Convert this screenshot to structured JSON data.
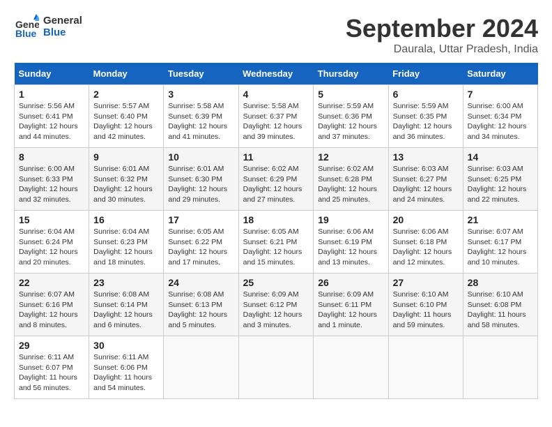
{
  "logo": {
    "line1": "General",
    "line2": "Blue"
  },
  "title": "September 2024",
  "location": "Daurala, Uttar Pradesh, India",
  "days_of_week": [
    "Sunday",
    "Monday",
    "Tuesday",
    "Wednesday",
    "Thursday",
    "Friday",
    "Saturday"
  ],
  "weeks": [
    [
      {
        "day": "1",
        "info": "Sunrise: 5:56 AM\nSunset: 6:41 PM\nDaylight: 12 hours\nand 44 minutes."
      },
      {
        "day": "2",
        "info": "Sunrise: 5:57 AM\nSunset: 6:40 PM\nDaylight: 12 hours\nand 42 minutes."
      },
      {
        "day": "3",
        "info": "Sunrise: 5:58 AM\nSunset: 6:39 PM\nDaylight: 12 hours\nand 41 minutes."
      },
      {
        "day": "4",
        "info": "Sunrise: 5:58 AM\nSunset: 6:37 PM\nDaylight: 12 hours\nand 39 minutes."
      },
      {
        "day": "5",
        "info": "Sunrise: 5:59 AM\nSunset: 6:36 PM\nDaylight: 12 hours\nand 37 minutes."
      },
      {
        "day": "6",
        "info": "Sunrise: 5:59 AM\nSunset: 6:35 PM\nDaylight: 12 hours\nand 36 minutes."
      },
      {
        "day": "7",
        "info": "Sunrise: 6:00 AM\nSunset: 6:34 PM\nDaylight: 12 hours\nand 34 minutes."
      }
    ],
    [
      {
        "day": "8",
        "info": "Sunrise: 6:00 AM\nSunset: 6:33 PM\nDaylight: 12 hours\nand 32 minutes."
      },
      {
        "day": "9",
        "info": "Sunrise: 6:01 AM\nSunset: 6:32 PM\nDaylight: 12 hours\nand 30 minutes."
      },
      {
        "day": "10",
        "info": "Sunrise: 6:01 AM\nSunset: 6:30 PM\nDaylight: 12 hours\nand 29 minutes."
      },
      {
        "day": "11",
        "info": "Sunrise: 6:02 AM\nSunset: 6:29 PM\nDaylight: 12 hours\nand 27 minutes."
      },
      {
        "day": "12",
        "info": "Sunrise: 6:02 AM\nSunset: 6:28 PM\nDaylight: 12 hours\nand 25 minutes."
      },
      {
        "day": "13",
        "info": "Sunrise: 6:03 AM\nSunset: 6:27 PM\nDaylight: 12 hours\nand 24 minutes."
      },
      {
        "day": "14",
        "info": "Sunrise: 6:03 AM\nSunset: 6:25 PM\nDaylight: 12 hours\nand 22 minutes."
      }
    ],
    [
      {
        "day": "15",
        "info": "Sunrise: 6:04 AM\nSunset: 6:24 PM\nDaylight: 12 hours\nand 20 minutes."
      },
      {
        "day": "16",
        "info": "Sunrise: 6:04 AM\nSunset: 6:23 PM\nDaylight: 12 hours\nand 18 minutes."
      },
      {
        "day": "17",
        "info": "Sunrise: 6:05 AM\nSunset: 6:22 PM\nDaylight: 12 hours\nand 17 minutes."
      },
      {
        "day": "18",
        "info": "Sunrise: 6:05 AM\nSunset: 6:21 PM\nDaylight: 12 hours\nand 15 minutes."
      },
      {
        "day": "19",
        "info": "Sunrise: 6:06 AM\nSunset: 6:19 PM\nDaylight: 12 hours\nand 13 minutes."
      },
      {
        "day": "20",
        "info": "Sunrise: 6:06 AM\nSunset: 6:18 PM\nDaylight: 12 hours\nand 12 minutes."
      },
      {
        "day": "21",
        "info": "Sunrise: 6:07 AM\nSunset: 6:17 PM\nDaylight: 12 hours\nand 10 minutes."
      }
    ],
    [
      {
        "day": "22",
        "info": "Sunrise: 6:07 AM\nSunset: 6:16 PM\nDaylight: 12 hours\nand 8 minutes."
      },
      {
        "day": "23",
        "info": "Sunrise: 6:08 AM\nSunset: 6:14 PM\nDaylight: 12 hours\nand 6 minutes."
      },
      {
        "day": "24",
        "info": "Sunrise: 6:08 AM\nSunset: 6:13 PM\nDaylight: 12 hours\nand 5 minutes."
      },
      {
        "day": "25",
        "info": "Sunrise: 6:09 AM\nSunset: 6:12 PM\nDaylight: 12 hours\nand 3 minutes."
      },
      {
        "day": "26",
        "info": "Sunrise: 6:09 AM\nSunset: 6:11 PM\nDaylight: 12 hours\nand 1 minute."
      },
      {
        "day": "27",
        "info": "Sunrise: 6:10 AM\nSunset: 6:10 PM\nDaylight: 11 hours\nand 59 minutes."
      },
      {
        "day": "28",
        "info": "Sunrise: 6:10 AM\nSunset: 6:08 PM\nDaylight: 11 hours\nand 58 minutes."
      }
    ],
    [
      {
        "day": "29",
        "info": "Sunrise: 6:11 AM\nSunset: 6:07 PM\nDaylight: 11 hours\nand 56 minutes."
      },
      {
        "day": "30",
        "info": "Sunrise: 6:11 AM\nSunset: 6:06 PM\nDaylight: 11 hours\nand 54 minutes."
      },
      {
        "day": "",
        "info": ""
      },
      {
        "day": "",
        "info": ""
      },
      {
        "day": "",
        "info": ""
      },
      {
        "day": "",
        "info": ""
      },
      {
        "day": "",
        "info": ""
      }
    ]
  ]
}
